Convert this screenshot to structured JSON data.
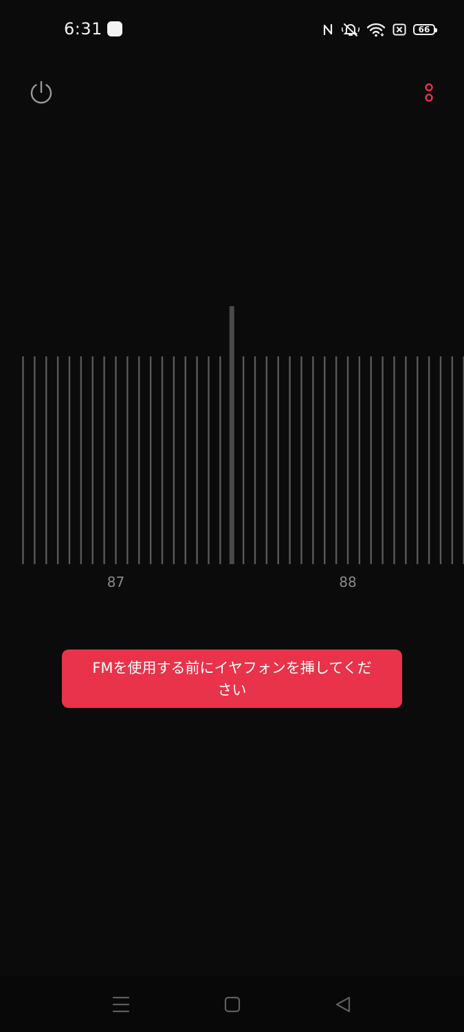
{
  "status_bar": {
    "time": "6:31",
    "battery_level": "66",
    "icons": [
      "app-notification-icon",
      "nfc-icon",
      "silent-icon",
      "wifi-icon",
      "sim-off-icon",
      "battery-icon"
    ]
  },
  "toolbar": {
    "power_icon": "power-icon",
    "more_icon": "more-vertical-icon"
  },
  "tuner": {
    "labels": [
      {
        "text": "87",
        "value": 87
      },
      {
        "text": "88",
        "value": 88
      }
    ],
    "current_frequency": 87.5,
    "range": [
      86.6,
      88.5
    ],
    "tick_step": 0.05
  },
  "toast": {
    "message": "FMを使用する前にイヤフォンを挿してください"
  },
  "colors": {
    "background": "#0b0b0b",
    "accent": "#e8334a",
    "tick": "#5a5a5a",
    "indicator": "#4a4a4a"
  },
  "nav": {
    "icons": [
      "menu-icon",
      "home-icon",
      "back-icon"
    ]
  }
}
